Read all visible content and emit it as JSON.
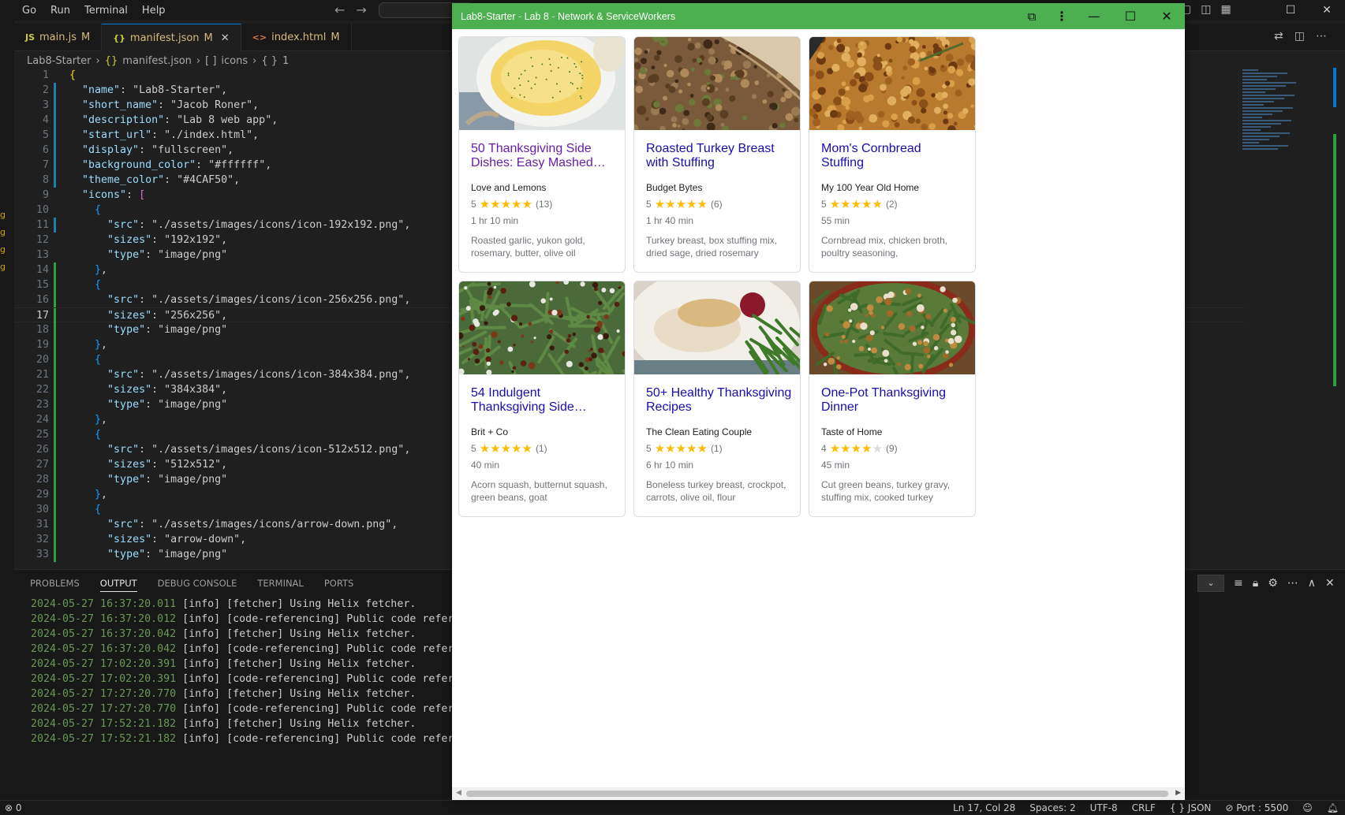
{
  "vscode": {
    "menu": [
      "Go",
      "Run",
      "Terminal",
      "Help"
    ],
    "tabs": [
      {
        "icon": "JS",
        "name": "main.js",
        "badge": "M",
        "active": false
      },
      {
        "icon": "{}",
        "name": "manifest.json",
        "badge": "M",
        "active": true
      },
      {
        "icon": "<>",
        "name": "index.html",
        "badge": "M",
        "active": false
      }
    ],
    "breadcrumb": {
      "folder": "Lab8-Starter",
      "file": "manifest.json",
      "icons_seg": "icons",
      "item_seg": "1"
    },
    "code_lines": [
      {
        "n": "1",
        "text": "{"
      },
      {
        "n": "2",
        "text": "  \"name\": \"Lab8-Starter\","
      },
      {
        "n": "3",
        "text": "  \"short_name\": \"Jacob Roner\","
      },
      {
        "n": "4",
        "text": "  \"description\": \"Lab 8 web app\","
      },
      {
        "n": "5",
        "text": "  \"start_url\": \"./index.html\","
      },
      {
        "n": "6",
        "text": "  \"display\": \"fullscreen\","
      },
      {
        "n": "7",
        "text": "  \"background_color\": \"#ffffff\","
      },
      {
        "n": "8",
        "text": "  \"theme_color\": \"#4CAF50\","
      },
      {
        "n": "9",
        "text": "  \"icons\": ["
      },
      {
        "n": "10",
        "text": "    {"
      },
      {
        "n": "11",
        "text": "      \"src\": \"./assets/images/icons/icon-192x192.png\","
      },
      {
        "n": "12",
        "text": "      \"sizes\": \"192x192\","
      },
      {
        "n": "13",
        "text": "      \"type\": \"image/png\""
      },
      {
        "n": "14",
        "text": "    },"
      },
      {
        "n": "15",
        "text": "    {"
      },
      {
        "n": "16",
        "text": "      \"src\": \"./assets/images/icons/icon-256x256.png\","
      },
      {
        "n": "17",
        "text": "      \"sizes\": \"256x256\","
      },
      {
        "n": "18",
        "text": "      \"type\": \"image/png\""
      },
      {
        "n": "19",
        "text": "    },"
      },
      {
        "n": "20",
        "text": "    {"
      },
      {
        "n": "21",
        "text": "      \"src\": \"./assets/images/icons/icon-384x384.png\","
      },
      {
        "n": "22",
        "text": "      \"sizes\": \"384x384\","
      },
      {
        "n": "23",
        "text": "      \"type\": \"image/png\""
      },
      {
        "n": "24",
        "text": "    },"
      },
      {
        "n": "25",
        "text": "    {"
      },
      {
        "n": "26",
        "text": "      \"src\": \"./assets/images/icons/icon-512x512.png\","
      },
      {
        "n": "27",
        "text": "      \"sizes\": \"512x512\","
      },
      {
        "n": "28",
        "text": "      \"type\": \"image/png\""
      },
      {
        "n": "29",
        "text": "    },"
      },
      {
        "n": "30",
        "text": "    {"
      },
      {
        "n": "31",
        "text": "      \"src\": \"./assets/images/icons/arrow-down.png\","
      },
      {
        "n": "32",
        "text": "      \"sizes\": \"arrow-down\","
      },
      {
        "n": "33",
        "text": "      \"type\": \"image/png\""
      }
    ],
    "current_line": "17",
    "panel_tabs": [
      "PROBLEMS",
      "OUTPUT",
      "DEBUG CONSOLE",
      "TERMINAL",
      "PORTS"
    ],
    "active_panel_tab": "OUTPUT",
    "output_lines": [
      {
        "ts": "2024-05-27 16:37:20.011",
        "msg": " [info] [fetcher] Using Helix fetcher."
      },
      {
        "ts": "2024-05-27 16:37:20.012",
        "msg": " [info] [code-referencing] Public code referen"
      },
      {
        "ts": "2024-05-27 16:37:20.042",
        "msg": " [info] [fetcher] Using Helix fetcher."
      },
      {
        "ts": "2024-05-27 16:37:20.042",
        "msg": " [info] [code-referencing] Public code referen"
      },
      {
        "ts": "2024-05-27 17:02:20.391",
        "msg": " [info] [fetcher] Using Helix fetcher."
      },
      {
        "ts": "2024-05-27 17:02:20.391",
        "msg": " [info] [code-referencing] Public code referen"
      },
      {
        "ts": "2024-05-27 17:27:20.770",
        "msg": " [info] [fetcher] Using Helix fetcher."
      },
      {
        "ts": "2024-05-27 17:27:20.770",
        "msg": " [info] [code-referencing] Public code referen"
      },
      {
        "ts": "2024-05-27 17:52:21.182",
        "msg": " [info] [fetcher] Using Helix fetcher."
      },
      {
        "ts": "2024-05-27 17:52:21.182",
        "msg": " [info] [code-referencing] Public code referen"
      }
    ],
    "status": {
      "left": "0",
      "position": "Ln 17, Col 28",
      "spaces": "Spaces: 2",
      "encoding": "UTF-8",
      "eol": "CRLF",
      "language": "{ } JSON",
      "port": "Port : 5500"
    }
  },
  "app": {
    "title": "Lab8-Starter - Lab 8 - Network & ServiceWorkers",
    "theme_color": "#4CAF50",
    "cards": [
      {
        "title": "50 Thanksgiving Side Dishes: Easy Mashed…",
        "visited": true,
        "source": "Love and Lemons",
        "rating": "5",
        "stars": 5,
        "reviews": "(13)",
        "time": "1 hr 10 min",
        "ingredients": "Roasted garlic, yukon gold, rosemary, butter, olive oil",
        "photo": "mashed-potatoes"
      },
      {
        "title": "Roasted Turkey Breast with Stuffing",
        "visited": false,
        "source": "Budget Bytes",
        "rating": "5",
        "stars": 5,
        "reviews": "(6)",
        "time": "1 hr 40 min",
        "ingredients": "Turkey breast, box stuffing mix, dried sage, dried rosemary",
        "photo": "turkey-stuffing"
      },
      {
        "title": "Mom's Cornbread Stuffing",
        "visited": false,
        "source": "My 100 Year Old Home",
        "rating": "5",
        "stars": 5,
        "reviews": "(2)",
        "time": "55 min",
        "ingredients": "Cornbread mix, chicken broth, poultry seasoning,",
        "photo": "cornbread-stuffing"
      },
      {
        "title": "54 Indulgent Thanksgiving Side…",
        "visited": false,
        "source": "Brit + Co",
        "rating": "5",
        "stars": 5,
        "reviews": "(1)",
        "time": "40 min",
        "ingredients": "Acorn squash, butternut squash, green beans, goat",
        "photo": "green-beans-pecans"
      },
      {
        "title": "50+ Healthy Thanksgiving Recipes",
        "visited": false,
        "source": "The Clean Eating Couple",
        "rating": "5",
        "stars": 5,
        "reviews": "(1)",
        "time": "6 hr 10 min",
        "ingredients": "Boneless turkey breast, crockpot, carrots, olive oil, flour",
        "photo": "turkey-plate"
      },
      {
        "title": "One-Pot Thanksgiving Dinner",
        "visited": false,
        "source": "Taste of Home",
        "rating": "4",
        "stars": 4,
        "reviews": "(9)",
        "time": "45 min",
        "ingredients": "Cut green beans, turkey gravy, stuffing mix, cooked turkey",
        "photo": "one-pot-dinner"
      }
    ]
  }
}
